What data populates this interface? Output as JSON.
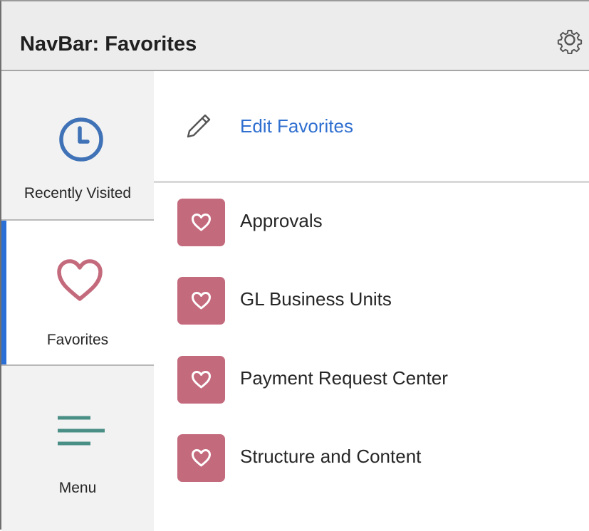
{
  "header": {
    "title": "NavBar: Favorites",
    "settings_icon": "gear-icon"
  },
  "sidebar": {
    "items": [
      {
        "label": "Recently Visited",
        "icon": "clock-icon",
        "selected": false
      },
      {
        "label": "Favorites",
        "icon": "heart-icon",
        "selected": true
      },
      {
        "label": "Menu",
        "icon": "menu-lines-icon",
        "selected": false
      }
    ]
  },
  "content": {
    "edit": {
      "label": "Edit Favorites",
      "icon": "pencil-icon"
    },
    "favorites": [
      {
        "label": "Approvals",
        "icon": "heart-icon"
      },
      {
        "label": "GL Business Units",
        "icon": "heart-icon"
      },
      {
        "label": "Payment Request Center",
        "icon": "heart-icon"
      },
      {
        "label": "Structure and Content",
        "icon": "heart-icon"
      }
    ]
  },
  "colors": {
    "accent": "#2a6fd6",
    "link": "#2f6fd0",
    "clock": "#3f72b6",
    "heart": "#c46a7d",
    "menu": "#4a8f86"
  }
}
